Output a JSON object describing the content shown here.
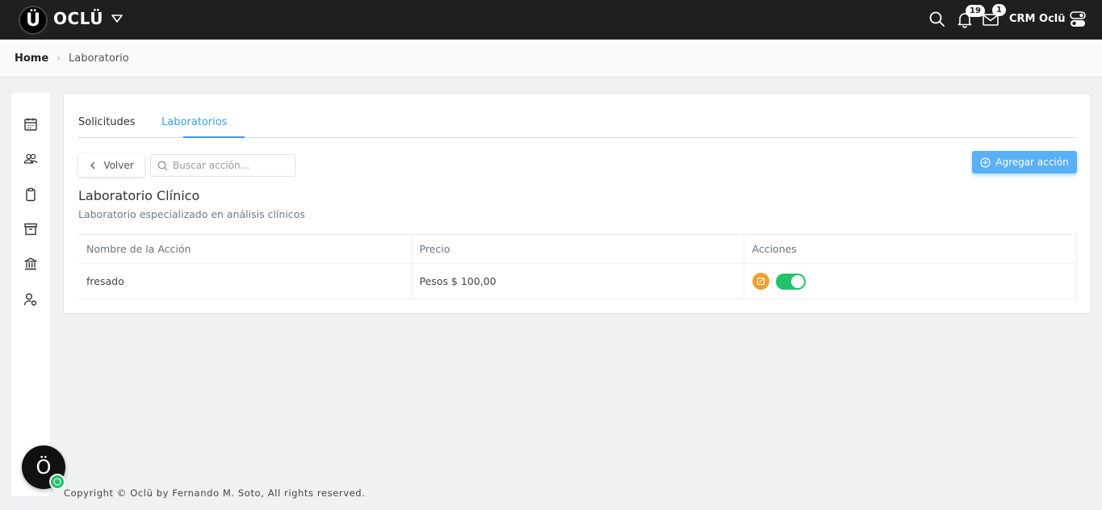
{
  "header": {
    "logo_letter": "Ü",
    "brand": "OCLÜ",
    "notifications_count": "19",
    "messages_count": "1",
    "user_name": "CRM Oclü"
  },
  "breadcrumb": {
    "home": "Home",
    "current": "Laboratorio"
  },
  "sidebar": {
    "items": [
      "calendar-icon",
      "users-icon",
      "clipboard-icon",
      "archive-icon",
      "bank-icon",
      "user-settings-icon"
    ]
  },
  "tabs": [
    {
      "label": "Solicitudes",
      "active": false
    },
    {
      "label": "Laboratorios",
      "active": true
    }
  ],
  "toolbar": {
    "back_label": "Volver",
    "search_placeholder": "Buscar acción...",
    "add_label": "Agregar acción"
  },
  "laboratory": {
    "title": "Laboratorio Clínico",
    "description": "Laboratorio especializado en análisis clínicos"
  },
  "table": {
    "columns": [
      "Nombre de la Acción",
      "Precio",
      "Acciones"
    ],
    "rows": [
      {
        "name": "fresado",
        "price": "Pesos $ 100,00",
        "enabled": true
      }
    ]
  },
  "footer": {
    "copyright": "Copyright © Oclü by Fernando M. Soto, All rights reserved."
  },
  "fab": {
    "letter": "Ö"
  },
  "colors": {
    "topbar": "#1f1f1f",
    "accent": "#3b9cf0",
    "add_button": "#5ab0f5",
    "edit": "#f0a030",
    "toggle_on": "#1fc46a"
  }
}
